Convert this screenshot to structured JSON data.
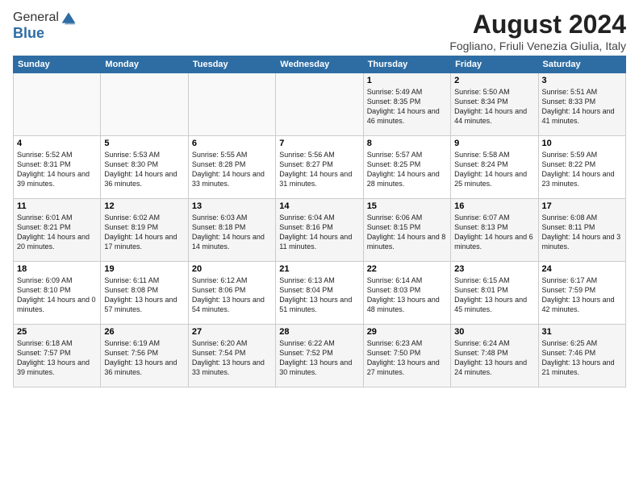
{
  "header": {
    "logo_general": "General",
    "logo_blue": "Blue",
    "month_year": "August 2024",
    "location": "Fogliano, Friuli Venezia Giulia, Italy"
  },
  "weekdays": [
    "Sunday",
    "Monday",
    "Tuesday",
    "Wednesday",
    "Thursday",
    "Friday",
    "Saturday"
  ],
  "weeks": [
    [
      {
        "day": "",
        "info": ""
      },
      {
        "day": "",
        "info": ""
      },
      {
        "day": "",
        "info": ""
      },
      {
        "day": "",
        "info": ""
      },
      {
        "day": "1",
        "info": "Sunrise: 5:49 AM\nSunset: 8:35 PM\nDaylight: 14 hours and 46 minutes."
      },
      {
        "day": "2",
        "info": "Sunrise: 5:50 AM\nSunset: 8:34 PM\nDaylight: 14 hours and 44 minutes."
      },
      {
        "day": "3",
        "info": "Sunrise: 5:51 AM\nSunset: 8:33 PM\nDaylight: 14 hours and 41 minutes."
      }
    ],
    [
      {
        "day": "4",
        "info": "Sunrise: 5:52 AM\nSunset: 8:31 PM\nDaylight: 14 hours and 39 minutes."
      },
      {
        "day": "5",
        "info": "Sunrise: 5:53 AM\nSunset: 8:30 PM\nDaylight: 14 hours and 36 minutes."
      },
      {
        "day": "6",
        "info": "Sunrise: 5:55 AM\nSunset: 8:28 PM\nDaylight: 14 hours and 33 minutes."
      },
      {
        "day": "7",
        "info": "Sunrise: 5:56 AM\nSunset: 8:27 PM\nDaylight: 14 hours and 31 minutes."
      },
      {
        "day": "8",
        "info": "Sunrise: 5:57 AM\nSunset: 8:25 PM\nDaylight: 14 hours and 28 minutes."
      },
      {
        "day": "9",
        "info": "Sunrise: 5:58 AM\nSunset: 8:24 PM\nDaylight: 14 hours and 25 minutes."
      },
      {
        "day": "10",
        "info": "Sunrise: 5:59 AM\nSunset: 8:22 PM\nDaylight: 14 hours and 23 minutes."
      }
    ],
    [
      {
        "day": "11",
        "info": "Sunrise: 6:01 AM\nSunset: 8:21 PM\nDaylight: 14 hours and 20 minutes."
      },
      {
        "day": "12",
        "info": "Sunrise: 6:02 AM\nSunset: 8:19 PM\nDaylight: 14 hours and 17 minutes."
      },
      {
        "day": "13",
        "info": "Sunrise: 6:03 AM\nSunset: 8:18 PM\nDaylight: 14 hours and 14 minutes."
      },
      {
        "day": "14",
        "info": "Sunrise: 6:04 AM\nSunset: 8:16 PM\nDaylight: 14 hours and 11 minutes."
      },
      {
        "day": "15",
        "info": "Sunrise: 6:06 AM\nSunset: 8:15 PM\nDaylight: 14 hours and 8 minutes."
      },
      {
        "day": "16",
        "info": "Sunrise: 6:07 AM\nSunset: 8:13 PM\nDaylight: 14 hours and 6 minutes."
      },
      {
        "day": "17",
        "info": "Sunrise: 6:08 AM\nSunset: 8:11 PM\nDaylight: 14 hours and 3 minutes."
      }
    ],
    [
      {
        "day": "18",
        "info": "Sunrise: 6:09 AM\nSunset: 8:10 PM\nDaylight: 14 hours and 0 minutes."
      },
      {
        "day": "19",
        "info": "Sunrise: 6:11 AM\nSunset: 8:08 PM\nDaylight: 13 hours and 57 minutes."
      },
      {
        "day": "20",
        "info": "Sunrise: 6:12 AM\nSunset: 8:06 PM\nDaylight: 13 hours and 54 minutes."
      },
      {
        "day": "21",
        "info": "Sunrise: 6:13 AM\nSunset: 8:04 PM\nDaylight: 13 hours and 51 minutes."
      },
      {
        "day": "22",
        "info": "Sunrise: 6:14 AM\nSunset: 8:03 PM\nDaylight: 13 hours and 48 minutes."
      },
      {
        "day": "23",
        "info": "Sunrise: 6:15 AM\nSunset: 8:01 PM\nDaylight: 13 hours and 45 minutes."
      },
      {
        "day": "24",
        "info": "Sunrise: 6:17 AM\nSunset: 7:59 PM\nDaylight: 13 hours and 42 minutes."
      }
    ],
    [
      {
        "day": "25",
        "info": "Sunrise: 6:18 AM\nSunset: 7:57 PM\nDaylight: 13 hours and 39 minutes."
      },
      {
        "day": "26",
        "info": "Sunrise: 6:19 AM\nSunset: 7:56 PM\nDaylight: 13 hours and 36 minutes."
      },
      {
        "day": "27",
        "info": "Sunrise: 6:20 AM\nSunset: 7:54 PM\nDaylight: 13 hours and 33 minutes."
      },
      {
        "day": "28",
        "info": "Sunrise: 6:22 AM\nSunset: 7:52 PM\nDaylight: 13 hours and 30 minutes."
      },
      {
        "day": "29",
        "info": "Sunrise: 6:23 AM\nSunset: 7:50 PM\nDaylight: 13 hours and 27 minutes."
      },
      {
        "day": "30",
        "info": "Sunrise: 6:24 AM\nSunset: 7:48 PM\nDaylight: 13 hours and 24 minutes."
      },
      {
        "day": "31",
        "info": "Sunrise: 6:25 AM\nSunset: 7:46 PM\nDaylight: 13 hours and 21 minutes."
      }
    ]
  ]
}
